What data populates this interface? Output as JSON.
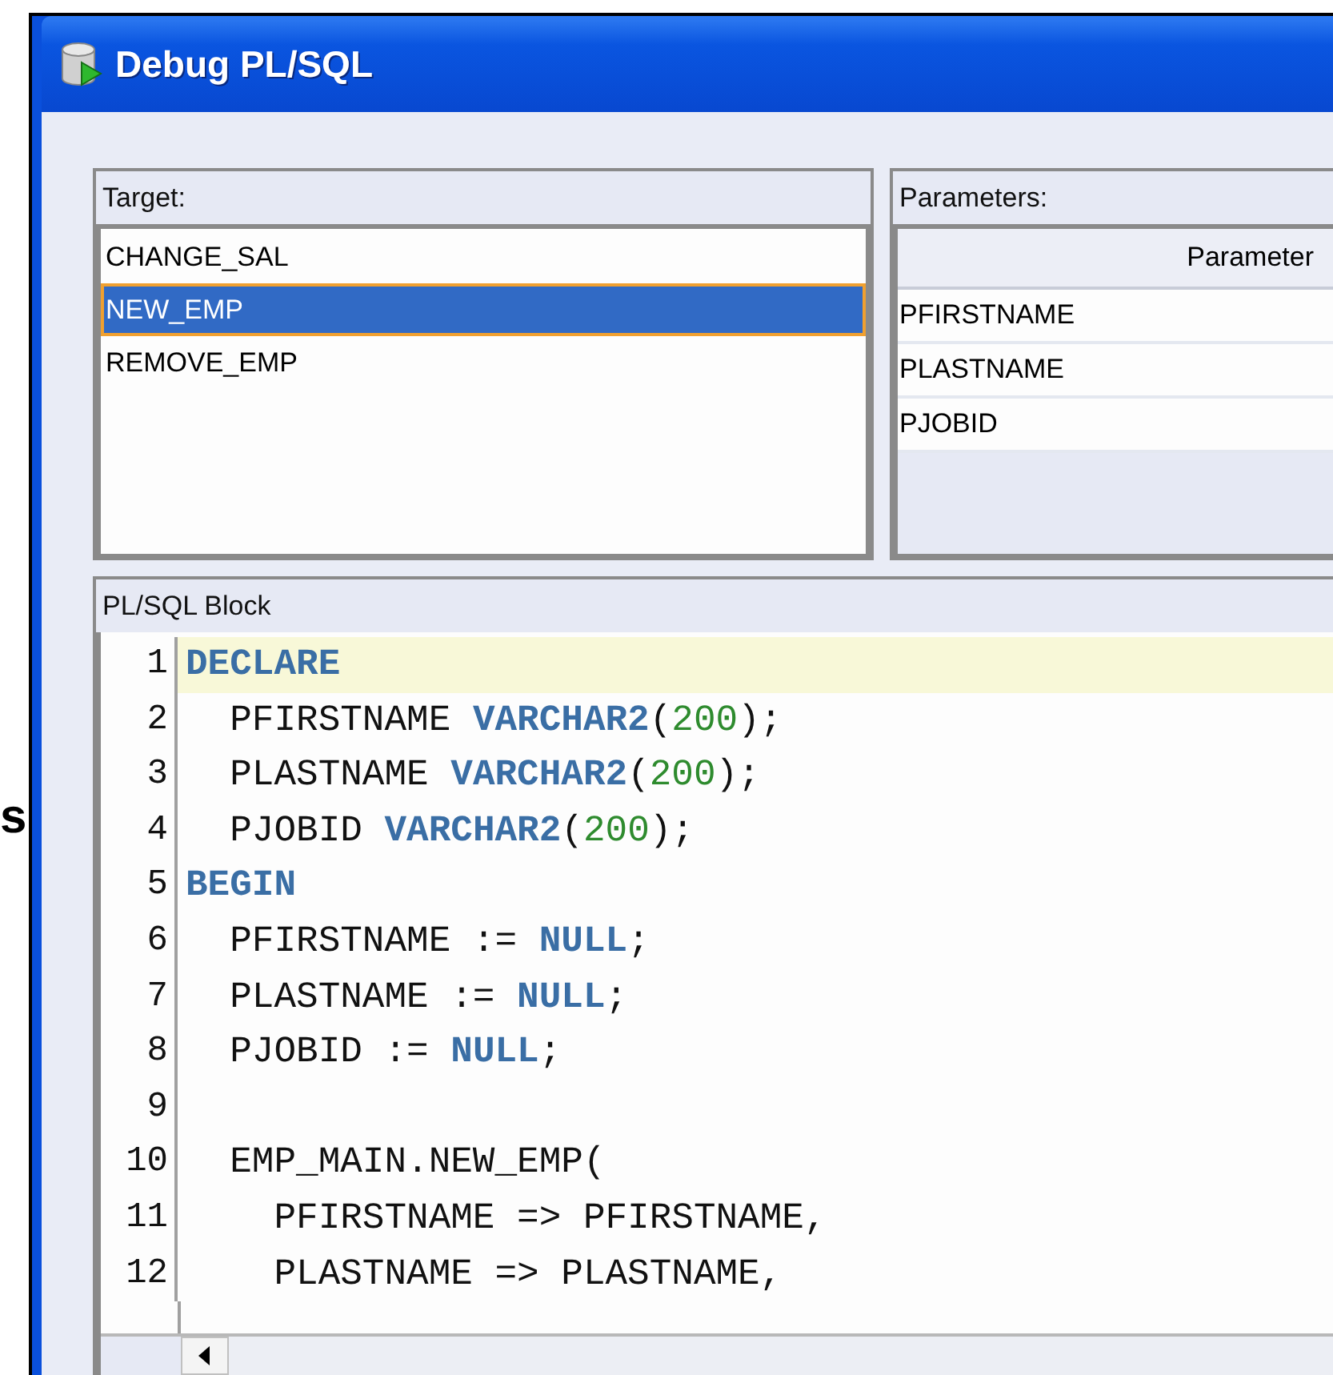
{
  "side_text": "s",
  "window": {
    "title": "Debug PL/SQL"
  },
  "target": {
    "label": "Target:",
    "items": [
      {
        "label": "CHANGE_SAL",
        "selected": false
      },
      {
        "label": "NEW_EMP",
        "selected": true
      },
      {
        "label": "REMOVE_EMP",
        "selected": false
      }
    ]
  },
  "parameters": {
    "label": "Parameters:",
    "columns": [
      "Parameter"
    ],
    "rows": [
      "PFIRSTNAME",
      "PLASTNAME",
      "PJOBID"
    ]
  },
  "plsql_block": {
    "label": "PL/SQL Block",
    "lines": [
      {
        "number": "1",
        "highlighted": true,
        "tokens": [
          {
            "text": "DECLARE",
            "kind": "keyword"
          }
        ]
      },
      {
        "number": "2",
        "highlighted": false,
        "tokens": [
          {
            "text": "  PFIRSTNAME ",
            "kind": "plain"
          },
          {
            "text": "VARCHAR2",
            "kind": "keyword"
          },
          {
            "text": "(",
            "kind": "plain"
          },
          {
            "text": "200",
            "kind": "number"
          },
          {
            "text": ");",
            "kind": "plain"
          }
        ]
      },
      {
        "number": "3",
        "highlighted": false,
        "tokens": [
          {
            "text": "  PLASTNAME ",
            "kind": "plain"
          },
          {
            "text": "VARCHAR2",
            "kind": "keyword"
          },
          {
            "text": "(",
            "kind": "plain"
          },
          {
            "text": "200",
            "kind": "number"
          },
          {
            "text": ");",
            "kind": "plain"
          }
        ]
      },
      {
        "number": "4",
        "highlighted": false,
        "tokens": [
          {
            "text": "  PJOBID ",
            "kind": "plain"
          },
          {
            "text": "VARCHAR2",
            "kind": "keyword"
          },
          {
            "text": "(",
            "kind": "plain"
          },
          {
            "text": "200",
            "kind": "number"
          },
          {
            "text": ");",
            "kind": "plain"
          }
        ]
      },
      {
        "number": "5",
        "highlighted": false,
        "tokens": [
          {
            "text": "BEGIN",
            "kind": "keyword"
          }
        ]
      },
      {
        "number": "6",
        "highlighted": false,
        "tokens": [
          {
            "text": "  PFIRSTNAME := ",
            "kind": "plain"
          },
          {
            "text": "NULL",
            "kind": "keyword"
          },
          {
            "text": ";",
            "kind": "plain"
          }
        ]
      },
      {
        "number": "7",
        "highlighted": false,
        "tokens": [
          {
            "text": "  PLASTNAME := ",
            "kind": "plain"
          },
          {
            "text": "NULL",
            "kind": "keyword"
          },
          {
            "text": ";",
            "kind": "plain"
          }
        ]
      },
      {
        "number": "8",
        "highlighted": false,
        "tokens": [
          {
            "text": "  PJOBID := ",
            "kind": "plain"
          },
          {
            "text": "NULL",
            "kind": "keyword"
          },
          {
            "text": ";",
            "kind": "plain"
          }
        ]
      },
      {
        "number": "9",
        "highlighted": false
      },
      {
        "number": "10",
        "highlighted": false,
        "tokens": [
          {
            "text": "  EMP_MAIN.NEW_EMP(",
            "kind": "plain"
          }
        ]
      },
      {
        "number": "11",
        "highlighted": false,
        "tokens": [
          {
            "text": "    PFIRSTNAME => PFIRSTNAME,",
            "kind": "plain"
          }
        ]
      },
      {
        "number": "12",
        "highlighted": false,
        "tokens": [
          {
            "text": "    PLASTNAME => PLASTNAME,",
            "kind": "plain"
          }
        ]
      }
    ]
  }
}
